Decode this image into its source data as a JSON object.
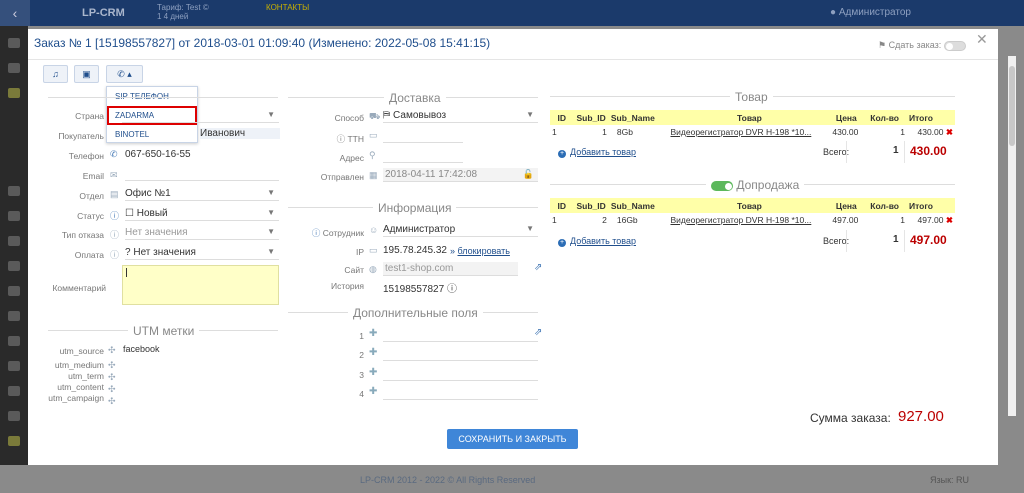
{
  "app": {
    "logo": "LP-CRM",
    "tarif": "Тариф: Test ©",
    "plan": "1 4 дней",
    "promo": "КОНТАКТЫ",
    "admin": "Администратор"
  },
  "modal": {
    "title": "Заказ № 1 [15198557827] от 2018-03-01 01:09:40 (Изменено: 2022-05-08 15:41:15)",
    "sdat_label": "Сдать заказ:",
    "dropdown": [
      "SIP ТЕЛЕФОН",
      "ZADARMA",
      "BINOTEL"
    ],
    "left": {
      "strana": "Страна",
      "pokupatel": "Покупатель",
      "pokupatel_val": "Иванович",
      "telefon": "Телефон",
      "telefon_val": "067-650-16-55",
      "email": "Email",
      "otdel": "Отдел",
      "otdel_val": "Офис №1",
      "status": "Статус",
      "status_val": "Новый",
      "tip": "Тип отказа",
      "tip_val": "Нет значения",
      "oplata": "Оплата",
      "oplata_val": "Нет значения",
      "komment": "Комментарий"
    },
    "utm": {
      "title": "UTM метки",
      "rows": [
        {
          "k": "utm_source",
          "v": "facebook"
        },
        {
          "k": "utm_medium",
          "v": ""
        },
        {
          "k": "utm_term",
          "v": ""
        },
        {
          "k": "utm_content",
          "v": ""
        },
        {
          "k": "utm_campaign",
          "v": ""
        }
      ]
    },
    "dostavka": {
      "title": "Доставка",
      "sposob": "Способ",
      "sposob_val": "Самовывоз",
      "ttn": "ТТН",
      "adres": "Адрес",
      "otpravlen": "Отправлен",
      "otpravlen_val": "2018-04-11 17:42:08"
    },
    "info": {
      "title": "Информация",
      "sotrudnik": "Сотрудник",
      "sotrudnik_val": "Администратор",
      "ip": "IP",
      "ip_val": "195.78.245.32",
      "block": "блокировать",
      "site": "Сайт",
      "site_val": "test1-shop.com",
      "history": "История",
      "history_val": "15198557827"
    },
    "dop": {
      "title": "Дополнительные поля",
      "rows": [
        "1",
        "2",
        "3",
        "4"
      ]
    },
    "tovar": {
      "title": "Товар",
      "headers": [
        "ID",
        "Sub_ID",
        "Sub_Name",
        "Товар",
        "Цена",
        "Кол-во",
        "Итого"
      ],
      "rows": [
        {
          "id": "1",
          "sub_id": "1",
          "sub_name": "8Gb",
          "tovar": "Видеорегистратор DVR H-198 *10...",
          "cena": "430.00",
          "kol": "1",
          "itogo": "430.00"
        }
      ],
      "add": "Добавить товар",
      "vsego": "Всего:",
      "qty": "1",
      "total": "430.00"
    },
    "doprodazha": {
      "title": "Допродажа",
      "headers": [
        "ID",
        "Sub_ID",
        "Sub_Name",
        "Товар",
        "Цена",
        "Кол-во",
        "Итого"
      ],
      "rows": [
        {
          "id": "1",
          "sub_id": "2",
          "sub_name": "16Gb",
          "tovar": "Видеорегистратор DVR H-198 *10...",
          "cena": "497.00",
          "kol": "1",
          "itogo": "497.00"
        }
      ],
      "add": "Добавить товар",
      "vsego": "Всего:",
      "qty": "1",
      "total": "497.00"
    },
    "summa_label": "Сумма заказа:",
    "summa_val": "927.00",
    "save": "СОХРАНИТЬ И ЗАКРЫТЬ"
  },
  "footer": {
    "text": "LP-CRM 2012 - 2022 © All Rights Reserved",
    "right": "Язык: RU"
  }
}
